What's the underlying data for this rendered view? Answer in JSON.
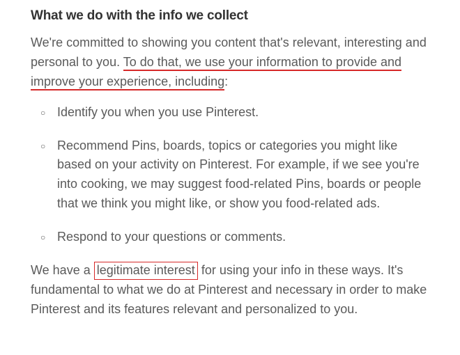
{
  "heading": "What we do with the info we collect",
  "intro": {
    "part1": "We're committed to showing you content that's relevant, interesting and personal to you. ",
    "underlined": "To do that, we use your information to provide and improve your experience, including",
    "part2": ":"
  },
  "bullets": [
    "Identify you when you use Pinterest.",
    "Recommend Pins, boards, topics or categories you might like based on your activity on Pinterest. For example, if we see you're into cooking, we may suggest food-related Pins, boards or people that we think you might like, or show you food-related ads.",
    "Respond to your questions or comments."
  ],
  "outro": {
    "part1": "We have a ",
    "boxed": "legitimate interest",
    "part2": " for using your info in these ways. It's fundamental to what we do at Pinterest and necessary in order to make Pinterest and its features relevant and personalized to you."
  }
}
